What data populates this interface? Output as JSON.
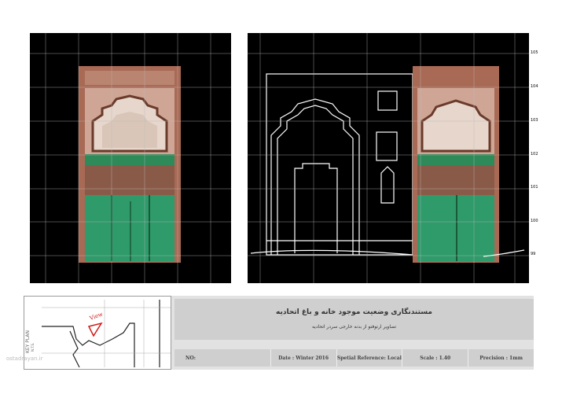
{
  "elevation_ticks": [
    "105",
    "104",
    "103",
    "102",
    "101",
    "100",
    "99"
  ],
  "title_block": {
    "title_fa": "مستندنگاری وضعیت موجود خانه و باغ اتحادیه",
    "subtitle_fa": "تصاویر ارتوفتو از بدنه خارجی سردر اتحادیه",
    "no": "NO:",
    "date": "Date : Winter 2016",
    "spatial_reference": "Spetial Reference: Local",
    "scale": "Scale : 1.40",
    "precision": "Precision : 1mm"
  },
  "key_plan": {
    "label": "KEY PLAN",
    "sublabel": "N.T.S.",
    "view_label": "View"
  },
  "watermark": "ostadrayan.ir",
  "colors": {
    "panel_bg": "#000000",
    "brick": "#a86a55",
    "door_green": "#2f9a6a",
    "grid_line": "#bbbbbb",
    "view_marker": "#d11a1a"
  }
}
